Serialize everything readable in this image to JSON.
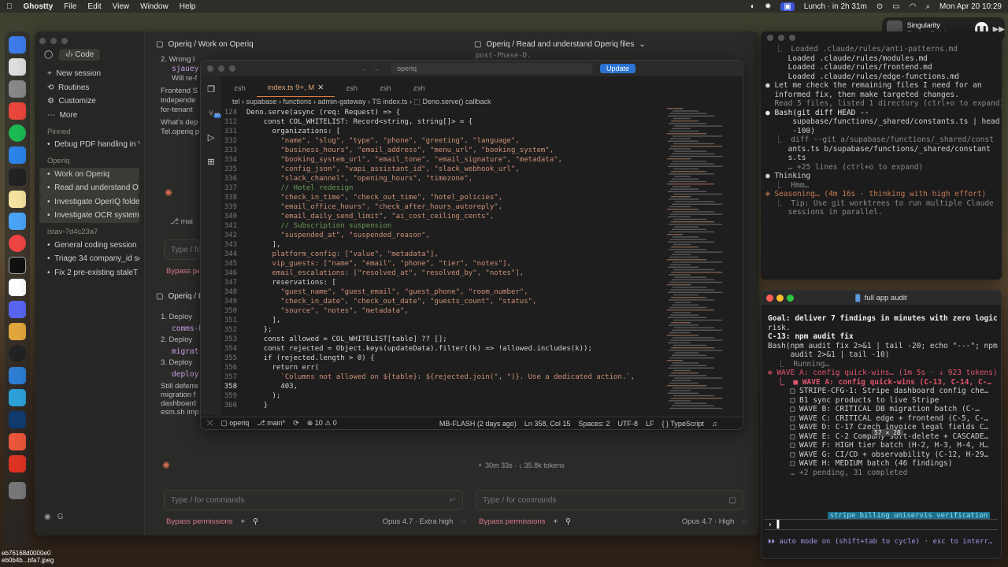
{
  "menubar": {
    "app": "Ghostty",
    "items": [
      "File",
      "Edit",
      "View",
      "Window",
      "Help"
    ],
    "lunch": "Lunch · in 2h 31m",
    "datetime": "Mon Apr 20  10:29"
  },
  "music": {
    "title": "Singularity",
    "artist": "Stephan Bodzin"
  },
  "claude": {
    "code_tab": "Code",
    "nav": [
      "New session",
      "Routines",
      "Customize",
      "More"
    ],
    "pinned_head": "Pinned",
    "pinned": [
      "Debug PDF handling in V"
    ],
    "operiq_head": "Operiq",
    "operiq_items": [
      "Work on Operiq",
      "Read and understand O",
      "Investigate OperIQ folde",
      "Investigate OCR system"
    ],
    "istav_head": "istav-7d4c23a7",
    "istav_items": [
      "General coding session",
      "Triage 34 company_id sc",
      "Fix 2 pre-existing staleT"
    ],
    "user_initial": "G",
    "pane_left_title": "Operiq / Work on Operiq",
    "pane_right_title": "Operiq / Read and understand Operiq files",
    "pane_left2_title": "Operiq / I",
    "left_snippets": [
      "2. Wrong l",
      "sjauey",
      "Will re-f",
      "Frontend S",
      "independe",
      "for-tenant",
      "What's dep",
      "Tel.operiq p",
      "mai"
    ],
    "left2_snippets": [
      "1. Deploy",
      "comms-h",
      "2. Deploy",
      "migrat",
      "3. Deploy",
      "deploy",
      "Still deferre",
      "migration f",
      "dashboard",
      "esm.sh imp"
    ],
    "right_top_snippet": "post-Phase-D.",
    "tokens": "30m 33s · ↓ 35.8k tokens",
    "type_placeholder": "Type / for commands",
    "bypass": "Bypass permissions",
    "model_left": "Opus 4.7 · Extra high",
    "model_right": "Opus 4.7 · High"
  },
  "vscode": {
    "search": "operiq",
    "update_btn": "Update",
    "tabs": [
      "zsh",
      "index.ts  9+, M",
      "zsh",
      "zsh",
      "zsh"
    ],
    "breadcrumb": "tel › supabase › functions › admin-gateway › TS index.ts › ⬚ Deno.serve() callback",
    "code": [
      {
        "n": "124",
        "t": "Deno.serve(async (req: Request) => {"
      },
      {
        "n": "312",
        "t": "    const COL_WHITELIST: Record<string, string[]> = {"
      },
      {
        "n": "331",
        "t": "      organizations: ["
      },
      {
        "n": "332",
        "t": "        \"name\", \"slug\", \"type\", \"phone\", \"greeting\", \"language\","
      },
      {
        "n": "333",
        "t": "        \"business_hours\", \"email_address\", \"menu_url\", \"booking_system\","
      },
      {
        "n": "334",
        "t": "        \"booking_system_url\", \"email_tone\", \"email_signature\", \"metadata\","
      },
      {
        "n": "335",
        "t": "        \"config_json\", \"vapi_assistant_id\", \"slack_webhook_url\","
      },
      {
        "n": "336",
        "t": "        \"slack_channel\", \"opening_hours\", \"timezone\","
      },
      {
        "n": "337",
        "t": "        // Hotel redesign"
      },
      {
        "n": "338",
        "t": "        \"check_in_time\", \"check_out_time\", \"hotel_policies\","
      },
      {
        "n": "339",
        "t": "        \"email_office_hours\", \"check_after_hours_autoreply\","
      },
      {
        "n": "340",
        "t": "        \"email_daily_send_limit\", \"ai_cost_ceiling_cents\","
      },
      {
        "n": "341",
        "t": "        // Subscription suspension"
      },
      {
        "n": "342",
        "t": "        \"suspended_at\", \"suspended_reason\","
      },
      {
        "n": "343",
        "t": "      ],"
      },
      {
        "n": "344",
        "t": "      platform_config: [\"value\", \"metadata\"],"
      },
      {
        "n": "345",
        "t": "      vip_guests: [\"name\", \"email\", \"phone\", \"tier\", \"notes\"],"
      },
      {
        "n": "346",
        "t": "      email_escalations: [\"resolved_at\", \"resolved_by\", \"notes\"],"
      },
      {
        "n": "347",
        "t": "      reservations: ["
      },
      {
        "n": "348",
        "t": "        \"guest_name\", \"guest_email\", \"guest_phone\", \"room_number\","
      },
      {
        "n": "349",
        "t": "        \"check_in_date\", \"check_out_date\", \"guests_count\", \"status\","
      },
      {
        "n": "350",
        "t": "        \"source\", \"notes\", \"metadata\","
      },
      {
        "n": "351",
        "t": "      ],"
      },
      {
        "n": "352",
        "t": "    };"
      },
      {
        "n": "353",
        "t": "    const allowed = COL_WHITELIST[table] ?? [];"
      },
      {
        "n": "354",
        "t": "    const rejected = Object.keys(updateData).filter((k) => !allowed.includes(k));"
      },
      {
        "n": "355",
        "t": "    if (rejected.length > 0) {"
      },
      {
        "n": "356",
        "t": "      return err("
      },
      {
        "n": "357",
        "t": "        `Columns not allowed on ${table}: ${rejected.join(\", \")}. Use a dedicated action.`,"
      },
      {
        "n": "358",
        "t": "        403,"
      },
      {
        "n": "359",
        "t": "      );"
      },
      {
        "n": "360",
        "t": "    }"
      }
    ],
    "status": {
      "repo": "operiq",
      "branch": "main*",
      "problems": "⊗ 10  ⚠ 0",
      "blame": "MB-FLASH (2 days ago)",
      "position": "Ln 358, Col 15",
      "spaces": "Spaces: 2",
      "encoding": "UTF-8",
      "eol": "LF",
      "lang": "{ } TypeScript"
    }
  },
  "term1": {
    "lines": [
      "  ⎿  Loaded .claude/rules/anti-patterns.md",
      "     Loaded .claude/rules/modules.md",
      "     Loaded .claude/rules/frontend.md",
      "     Loaded .claude/rules/edge-functions.md",
      "",
      "● Let me check the remaining files I need for an",
      "  informed fix, then make targeted changes.",
      "",
      "  Read 5 files, listed 1 directory (ctrl+o to expand)",
      "",
      "● Bash(git diff HEAD --",
      "      supabase/functions/_shared/constants.ts | head",
      "      -100)",
      "  ⎿  diff --git a/supabase/functions/_shared/const",
      "     ants.ts b/supabase/functions/_shared/constant",
      "     s.ts",
      "     … +25 lines (ctrl+o to expand)",
      "",
      "● Thinking",
      "  ⎿  Hmm…",
      "",
      "✻ Seasoning… (4m 16s · thinking with high effort)",
      "  ⎿  Tip: Use git worktrees to run multiple Claude",
      "     sessions in parallel."
    ],
    "prompt": "›"
  },
  "term2": {
    "title": "full app audit",
    "lines": [
      "Goal: deliver 7 findings in minutes with zero logic",
      "risk.",
      "",
      "C-13: npm audit fix",
      "",
      "Bash(npm audit fix 2>&1 | tail -20; echo \"---\"; npm",
      "     audit 2>&1 | tail -10)",
      "  ⎿  Running…",
      "",
      "✻ WAVE A: config quick-wins… (1m 5s · ↓ 923 tokens)",
      "  ⎿  ■ WAVE A: config quick-wins (C-13, C-14, C-…",
      "     □ STRIPE-CFG-1: Stripe dashboard config che…",
      "     □ B1 sync products to live Stripe",
      "     □ WAVE B: CRITICAL DB migration batch (C-…",
      "     □ WAVE C: CRITICAL edge + frontend (C-5, C-…",
      "     □ WAVE D: C-17 Czech invoice legal fields C…",
      "     □ WAVE E: C-2 Company soft-delete + CASCADE…",
      "     □ WAVE F: HIGH tier batch (H-2, H-3, H-4, H…",
      "     □ WAVE G: CI/CD + observability (C-12, H-29…",
      "     □ WAVE H: MEDIUM batch (46 findings)",
      "     … +2 pending, 31 completed"
    ],
    "overlay": "57 × 28",
    "badge": "stripe billing uniservis verification",
    "auto_mode": "⏵⏵ auto mode on (shift+tab to cycle) · esc to interr…"
  },
  "desktop": {
    "file1": "eb76168d0000e0",
    "file2": "eb0b4b...bfa7.jpeg"
  }
}
